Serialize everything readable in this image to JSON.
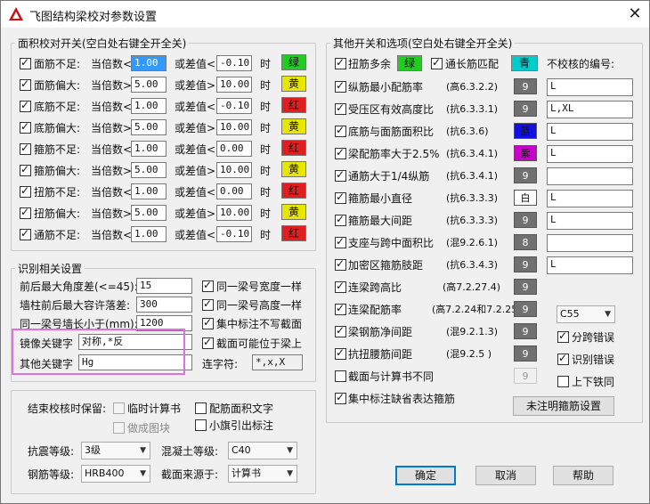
{
  "window": {
    "title": "飞图结构梁校对参数设置"
  },
  "area_group": {
    "title": "面积校对开关(空白处右键全开全关)",
    "rows": [
      {
        "label": "面筋不足:",
        "mult_label": "当倍数<",
        "mult": "1.00",
        "diff_label": "或差值<",
        "diff": "-0.10",
        "time": "时",
        "color_label": "绿",
        "color": "#22cc22",
        "selected": true
      },
      {
        "label": "面筋偏大:",
        "mult_label": "当倍数>",
        "mult": "5.00",
        "diff_label": "或差值>",
        "diff": "10.00",
        "time": "时",
        "color_label": "黄",
        "color": "#e6e600",
        "selected": false
      },
      {
        "label": "底筋不足:",
        "mult_label": "当倍数<",
        "mult": "1.00",
        "diff_label": "或差值<",
        "diff": "-0.10",
        "time": "时",
        "color_label": "红",
        "color": "#e02020",
        "selected": false
      },
      {
        "label": "底筋偏大:",
        "mult_label": "当倍数>",
        "mult": "5.00",
        "diff_label": "或差值>",
        "diff": "10.00",
        "time": "时",
        "color_label": "黄",
        "color": "#e6e600",
        "selected": false
      },
      {
        "label": "箍筋不足:",
        "mult_label": "当倍数<",
        "mult": "1.00",
        "diff_label": "或差值<",
        "diff": "0.00",
        "time": "时",
        "color_label": "红",
        "color": "#e02020",
        "selected": false
      },
      {
        "label": "箍筋偏大:",
        "mult_label": "当倍数>",
        "mult": "5.00",
        "diff_label": "或差值>",
        "diff": "10.00",
        "time": "时",
        "color_label": "黄",
        "color": "#e6e600",
        "selected": false
      },
      {
        "label": "扭筋不足:",
        "mult_label": "当倍数<",
        "mult": "1.00",
        "diff_label": "或差值<",
        "diff": "0.00",
        "time": "时",
        "color_label": "红",
        "color": "#e02020",
        "selected": false
      },
      {
        "label": "扭筋偏大:",
        "mult_label": "当倍数>",
        "mult": "5.00",
        "diff_label": "或差值>",
        "diff": "10.00",
        "time": "时",
        "color_label": "黄",
        "color": "#e6e600",
        "selected": false
      },
      {
        "label": "通筋不足:",
        "mult_label": "当倍数<",
        "mult": "1.00",
        "diff_label": "或差值<",
        "diff": "-0.10",
        "time": "时",
        "color_label": "红",
        "color": "#e02020",
        "selected": false
      }
    ]
  },
  "recog_group": {
    "title": "识别相关设置",
    "fields": [
      {
        "label": "前后最大角度差(<=45):",
        "value": "15"
      },
      {
        "label": "墙柱前后最大容许落差:",
        "value": "300"
      },
      {
        "label": "同一梁号墙长小于(mm):",
        "value": "1200"
      },
      {
        "label": "镜像关键字",
        "value": "对称,*反"
      },
      {
        "label": "其他关键字",
        "value": "Hg"
      }
    ],
    "checks": [
      {
        "label": "同一梁号宽度一样",
        "checked": true
      },
      {
        "label": "同一梁号高度一样",
        "checked": true
      },
      {
        "label": "集中标注不写截面",
        "checked": true
      },
      {
        "label": "截面可能位于梁上",
        "checked": true
      }
    ],
    "connector_label": "连字符:",
    "connector_value": "*,x,X"
  },
  "end_group": {
    "label": "结束校核时保留:",
    "temp_calc": "临时计算书",
    "rebar_area_text": "配筋面积文字",
    "make_block": "做成图块",
    "flag_callout": "小旗引出标注",
    "seismic_label": "抗震等级:",
    "seismic_value": "3级",
    "concrete_label": "混凝土等级:",
    "concrete_value": "C40",
    "steel_label": "钢筋等级:",
    "steel_value": "HRB400",
    "section_label": "截面来源于:",
    "section_value": "计算书"
  },
  "other_group": {
    "title": "其他开关和选项(空白处右键全开全关)",
    "twist_label": "扭筋多余",
    "twist_color_label": "绿",
    "twist_color": "#22cc22",
    "through_label": "通长筋匹配",
    "through_color_label": "青",
    "through_color": "#00cccc",
    "uncheck_label": "不校核的编号:",
    "rows": [
      {
        "label": "纵筋最小配筋率",
        "code": "(高6.3.2.2)",
        "num": "9",
        "value": "L",
        "checked": true
      },
      {
        "label": "受压区有效高度比",
        "code": "(抗6.3.3.1)",
        "num": "9",
        "value": "L,XL",
        "checked": true
      },
      {
        "label": "底筋与面筋面积比",
        "code": "(抗6.3.6)",
        "num": "蓝",
        "num_color": "#1010e0",
        "value": "L",
        "checked": true
      },
      {
        "label": "梁配筋率大于2.5%",
        "code": "(抗6.3.4.1)",
        "num": "紫",
        "num_color": "#cc00cc",
        "value": "L",
        "checked": true
      },
      {
        "label": "通筋大于1/4纵筋",
        "code": "(抗6.3.4.1)",
        "num": "9",
        "value": "",
        "checked": true
      },
      {
        "label": "箍筋最小直径",
        "code": "(抗6.3.3.3)",
        "num": "白",
        "num_color": "#ffffff",
        "value": "L",
        "checked": true
      },
      {
        "label": "箍筋最大间距",
        "code": "(抗6.3.3.3)",
        "num": "9",
        "value": "L",
        "checked": true
      },
      {
        "label": "支座与跨中面积比",
        "code": "(混9.2.6.1)",
        "num": "8",
        "value": "",
        "checked": true
      },
      {
        "label": "加密区箍筋肢距",
        "code": "(抗6.3.4.3)",
        "num": "9",
        "value": "L",
        "checked": true
      },
      {
        "label": "连梁跨高比",
        "code": "(高7.2.27.4)",
        "num": "9",
        "value": "",
        "checked": true
      },
      {
        "label": "连梁配筋率",
        "code": "(高7.2.24和7.2.25)",
        "num": "9",
        "value": "",
        "checked": true
      },
      {
        "label": "梁钢筋净间距",
        "code": "(混9.2.1.3)",
        "num": "9",
        "value": "",
        "checked": true
      },
      {
        "label": "抗扭腰筋间距",
        "code": "(混9.2.5 )",
        "num": "9",
        "value": "",
        "checked": true
      },
      {
        "label": "截面与计算书不同",
        "code": "",
        "num": "9",
        "value": "",
        "checked": false
      },
      {
        "label": "集中标注缺省表达箍筋",
        "code": "",
        "num": "",
        "value": "",
        "checked": true
      }
    ],
    "c55": "C55",
    "span_error": "分跨错误",
    "recog_error": "识别错误",
    "up_down": "上下铁同",
    "unnoted_button": "未注明箍筋设置"
  },
  "buttons": {
    "ok": "确定",
    "cancel": "取消",
    "help": "帮助"
  }
}
